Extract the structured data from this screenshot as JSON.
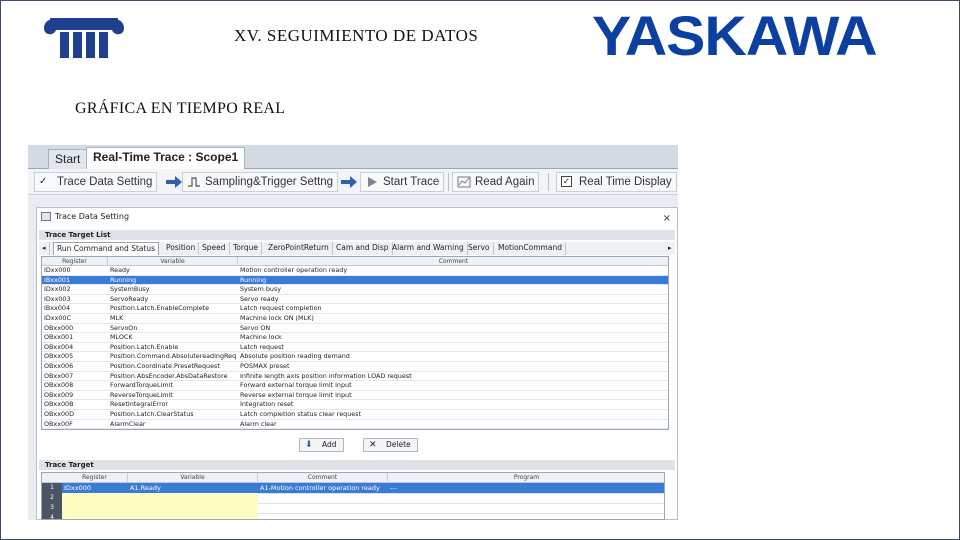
{
  "slide": {
    "title": "XV. SEGUIMIENTO DE DATOS",
    "brand": "YASKAWA",
    "subtitle": "GRÁFICA EN TIEMPO REAL"
  },
  "app": {
    "tabs": [
      "Start",
      "Real-Time Trace : Scope1"
    ],
    "toolbar": {
      "trace_data_setting": "Trace Data Setting",
      "sampling_trigger": "Sampling&Trigger Settng",
      "start_trace": "Start Trace",
      "read_again": "Read Again",
      "real_time_display": "Real Time Display"
    },
    "dialog": {
      "title": "Trace Data Setting",
      "close": "×",
      "trace_target_list_header": "Trace Target List",
      "subtabs": [
        "Run Command and Status",
        "Position",
        "Speed",
        "Torque",
        "ZeroPointReturn",
        "Cam and Disp",
        "Alarm and Warning",
        "Servo",
        "MotionCommand"
      ],
      "grid_headers": [
        "Register",
        "Variable",
        "Comment"
      ],
      "rows": [
        [
          "IDxx000",
          "Ready",
          "Motion controller operation ready"
        ],
        [
          "IBxx001",
          "Running",
          "Running"
        ],
        [
          "IDxx002",
          "SystemBusy",
          "System busy"
        ],
        [
          "IDxx003",
          "ServoReady",
          "Servo ready"
        ],
        [
          "IBxx004",
          "Position.Latch.EnableComplete",
          "Latch request completion"
        ],
        [
          "IDxx00C",
          "MLK",
          "Machine lock ON (MLK)"
        ],
        [
          "OBxx000",
          "ServoOn",
          "Servo ON"
        ],
        [
          "OBxx001",
          "MLOCK",
          "Machine lock"
        ],
        [
          "OBxx004",
          "Position.Latch.Enable",
          "Latch request"
        ],
        [
          "OBxx005",
          "Position.Command.AbsolutereadingReq",
          "Absolute position reading demand"
        ],
        [
          "OBxx006",
          "Position.Coordinate.PresetRequest",
          "POSMAX preset"
        ],
        [
          "OBxx007",
          "Position.AbsEncoder.AbsDataRestore",
          "Infinite length axis position information LOAD request"
        ],
        [
          "OBxx008",
          "ForwardTorqueLimit",
          "Forward external torque limit input"
        ],
        [
          "OBxx009",
          "ReverseTorqueLimit",
          "Reverse external torque limit input"
        ],
        [
          "OBxx00B",
          "ResetIntegralError",
          "Integration reset"
        ],
        [
          "OBxx00D",
          "Position.Latch.ClearStatus",
          "Latch completion status clear request"
        ],
        [
          "OBxx00F",
          "AlarmClear",
          "Alarm clear"
        ]
      ],
      "add_label": "Add",
      "delete_label": "Delete",
      "trace_target_header": "Trace Target",
      "target_headers": [
        "Register",
        "Variable",
        "Comment",
        "Program"
      ],
      "targets": [
        {
          "num": "1",
          "register": "IDxx000",
          "variable": "A1.Ready",
          "comment": "A1-Motion controller operation ready",
          "program": "---"
        },
        {
          "num": "2",
          "register": "",
          "variable": "",
          "comment": "",
          "program": ""
        },
        {
          "num": "3",
          "register": "",
          "variable": "",
          "comment": "",
          "program": ""
        },
        {
          "num": "4",
          "register": "",
          "variable": "",
          "comment": "",
          "program": ""
        }
      ]
    }
  },
  "colors": {
    "brand": "#0b3fa0",
    "selection": "#3a7bd5",
    "arrow": "#2f5fb3"
  }
}
